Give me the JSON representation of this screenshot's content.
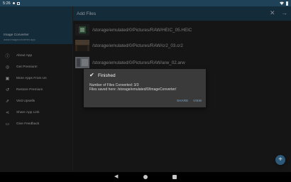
{
  "status_bar": {
    "time": "5:26",
    "icons": [
      "dot-icon",
      "square-icon",
      "wifi-icon",
      "battery-icon"
    ]
  },
  "drawer": {
    "app_name": "Image Converter",
    "app_url": "www.imageconverter.app",
    "items": [
      {
        "label": "About App",
        "icon": "info-icon"
      },
      {
        "label": "Get Premium!",
        "icon": "premium-icon"
      },
      {
        "label": "More Apps From Us",
        "icon": "apps-icon"
      },
      {
        "label": "Restore Premium",
        "icon": "restore-icon"
      },
      {
        "label": "Visit Upsells",
        "icon": "upsell-icon"
      },
      {
        "label": "Share App Link",
        "icon": "share-icon"
      },
      {
        "label": "Give Feedback",
        "icon": "feedback-icon"
      }
    ]
  },
  "appbar": {
    "title": "Add Files",
    "close_icon": "close-icon",
    "next_icon": "arrow-right-icon"
  },
  "files": [
    {
      "path": "/storage/emulated/0/Pictures/RAW/HEIC_05.HEIC"
    },
    {
      "path": "/storage/emulated/0/Pictures/RAW/cr2_03.cr2"
    },
    {
      "path": "/storage/emulated/0/Pictures/RAW/arw_02.arw"
    }
  ],
  "dialog": {
    "title": "Finished",
    "line1": "Number of Files Converted: 3/3",
    "line2": "Files saved here: /storage/emulated/0/ImageConverter/",
    "share_label": "SHARE",
    "view_label": "VIEW"
  },
  "fab": {
    "label": "+"
  },
  "colors": {
    "primary": "#1f4259",
    "accent": "#7aa6c8",
    "background": "#212121",
    "dialog": "#3a3a3a"
  }
}
